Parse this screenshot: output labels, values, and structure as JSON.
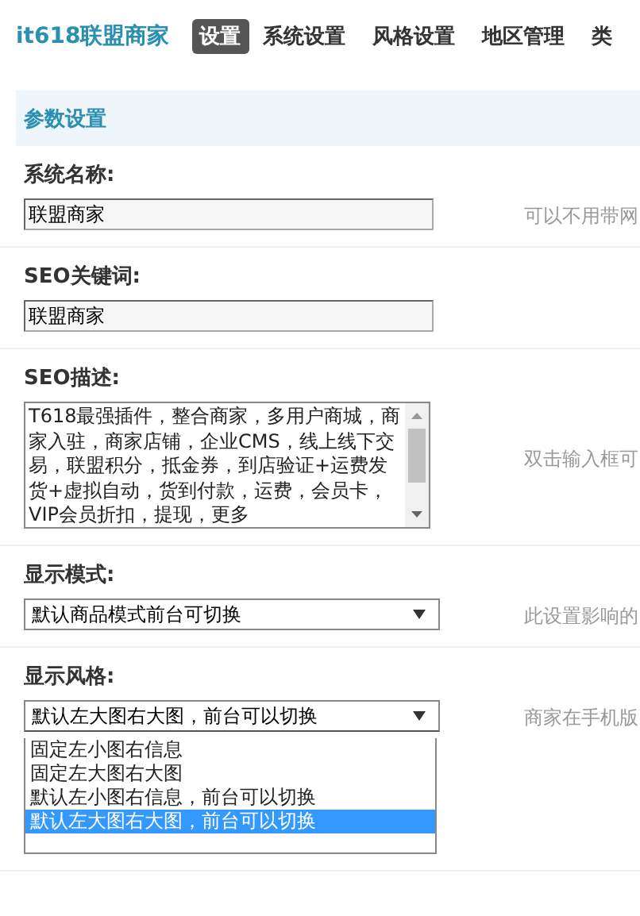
{
  "brand": "it618联盟商家",
  "tabs": [
    {
      "label": "设置",
      "selected": true
    },
    {
      "label": "系统设置",
      "selected": false
    },
    {
      "label": "风格设置",
      "selected": false
    },
    {
      "label": "地区管理",
      "selected": false
    },
    {
      "label": "类",
      "selected": false
    }
  ],
  "section": {
    "title": "参数设置"
  },
  "fields": [
    {
      "kind": "text",
      "label": "系统名称:",
      "value": "联盟商家",
      "hint": "可以不用带网"
    },
    {
      "kind": "text",
      "label": "SEO关键词:",
      "value": "联盟商家"
    },
    {
      "kind": "textarea",
      "label": "SEO描述:",
      "value": "T618最强插件，整合商家，多用户商城，商家入驻，商家店铺，企业CMS，线上线下交易，联盟积分，抵金券，到店验证+运费发货+虚拟自动，货到付款，运费，会员卡，VIP会员折扣，提现，更多",
      "hint": "双击输入框可"
    },
    {
      "kind": "select",
      "label": "显示模式:",
      "value": "默认商品模式前台可切换",
      "hint": "此设置影响的"
    },
    {
      "kind": "select",
      "label": "显示风格:",
      "value": "默认左大图右大图，前台可以切换",
      "hint": "商家在手机版",
      "expanded": true,
      "options": [
        {
          "label": "固定左小图右信息",
          "selected": false
        },
        {
          "label": "固定左大图右大图",
          "selected": false
        },
        {
          "label": "默认左小图右信息，前台可以切换",
          "selected": false
        },
        {
          "label": "默认左大图右大图，前台可以切换",
          "selected": true
        }
      ]
    }
  ]
}
